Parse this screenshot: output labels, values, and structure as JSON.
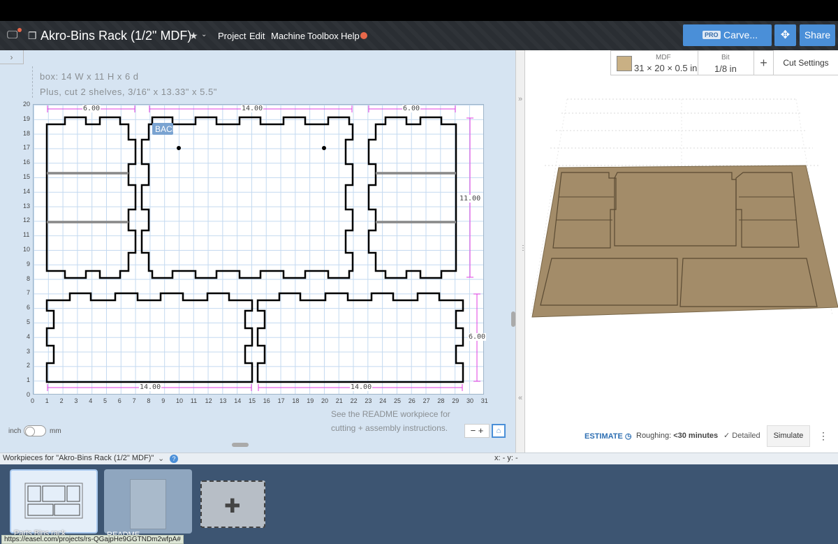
{
  "header": {
    "title": "Akro-Bins Rack (1/2\" MDF)",
    "menu": [
      "Project",
      "Edit",
      "Machine",
      "Toolbox",
      "Help"
    ],
    "carve_pro": "PRO",
    "carve_label": "Carve...",
    "share_label": "Share"
  },
  "canvas": {
    "note_line1": "box:  14 W x 11 H x 6 d",
    "note_line2": "Plus, cut 2 shelves, 3/16\" x 13.33\" x 5.5\"",
    "back_label": "BACK",
    "dim_top_left": "6.00",
    "dim_top_center": "14.00",
    "dim_top_right": "6.00",
    "dim_right_upper": "11.00",
    "dim_right_lower": "6.00",
    "dim_bottom_left": "14.00",
    "dim_bottom_right": "14.00",
    "x_ticks": [
      "0",
      "1",
      "2",
      "3",
      "4",
      "5",
      "6",
      "7",
      "8",
      "9",
      "10",
      "11",
      "12",
      "13",
      "14",
      "15",
      "16",
      "17",
      "18",
      "19",
      "20",
      "21",
      "22",
      "23",
      "24",
      "25",
      "26",
      "27",
      "28",
      "29",
      "30",
      "31"
    ],
    "y_ticks": [
      "0",
      "1",
      "2",
      "3",
      "4",
      "5",
      "6",
      "7",
      "8",
      "9",
      "10",
      "11",
      "12",
      "13",
      "14",
      "15",
      "16",
      "17",
      "18",
      "19",
      "20"
    ],
    "readme_line1": "See the README workpiece for",
    "readme_line2": "cutting + assembly instructions.",
    "unit_inch": "inch",
    "unit_mm": "mm",
    "zoom_label": "− +"
  },
  "material": {
    "label": "MDF",
    "size": "31 × 20 × 0.5 in",
    "swatch_color": "#c9b084"
  },
  "bit": {
    "label": "Bit",
    "size": "1/8 in"
  },
  "cut_settings": "Cut Settings",
  "estimate": {
    "label": "ESTIMATE",
    "roughing_label": "Roughing:",
    "roughing_value": "<30 minutes",
    "detailed": "Detailed",
    "simulate": "Simulate"
  },
  "workpieces": {
    "title": "Workpieces for \"Akro-Bins Rack (1/2\" MDF)\"",
    "coords": "x: - y: -",
    "items": [
      "Parts Bins rack",
      "README"
    ]
  },
  "status_url": "https://easel.com/projects/rs-QGajpHe9GGTNDm2wfpA#"
}
